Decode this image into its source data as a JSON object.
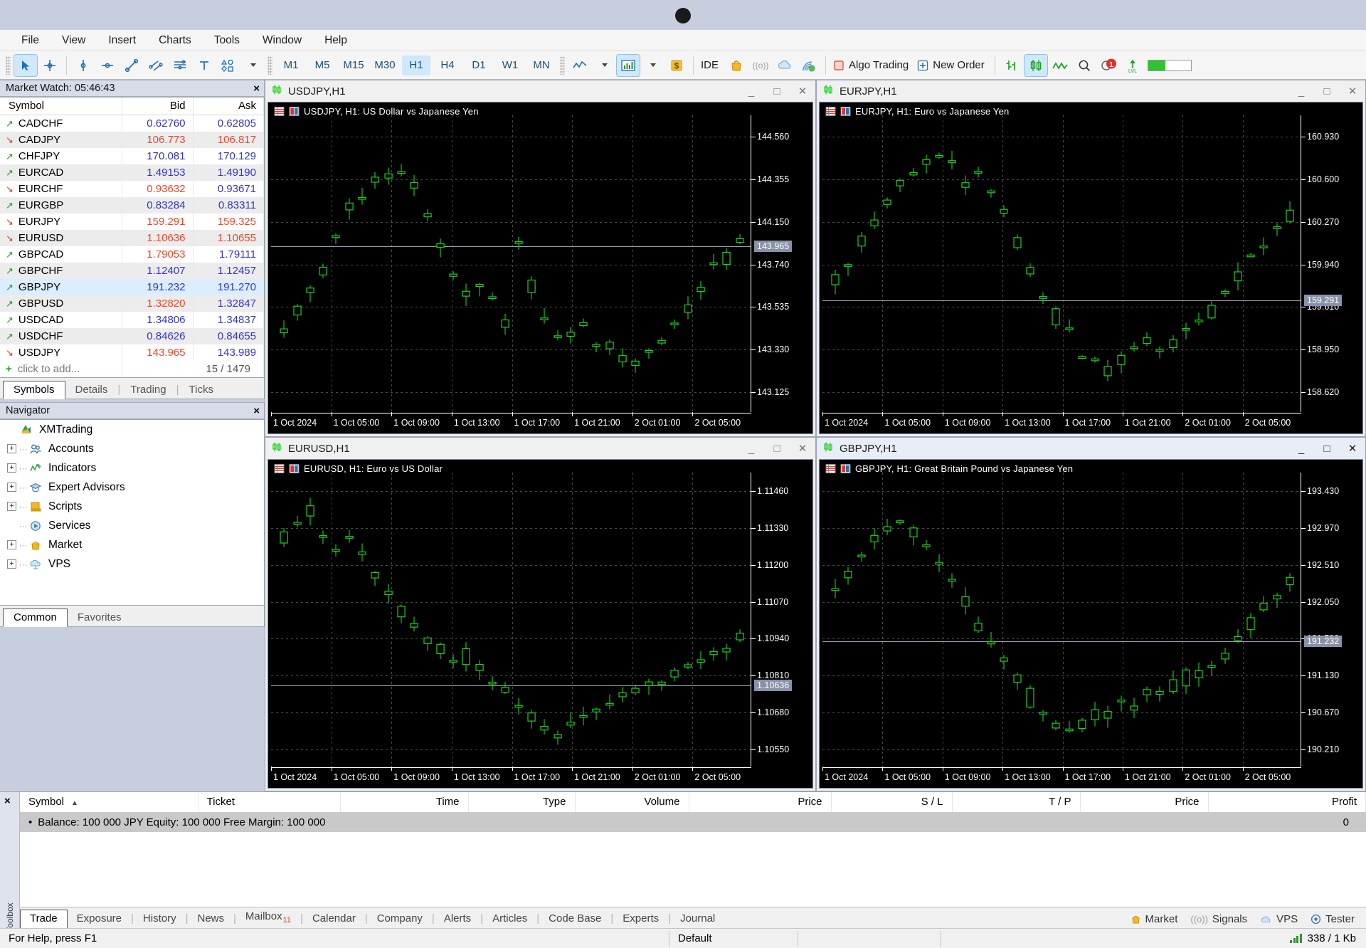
{
  "menu": [
    "File",
    "View",
    "Insert",
    "Charts",
    "Tools",
    "Window",
    "Help"
  ],
  "toolbar": {
    "timeframes": [
      "M1",
      "M5",
      "M15",
      "M30",
      "H1",
      "H4",
      "D1",
      "W1",
      "MN"
    ],
    "active_timeframe": "H1",
    "ide_label": "IDE",
    "algo_trading_label": "Algo Trading",
    "new_order_label": "New Order",
    "notification_badge": "1"
  },
  "market_watch": {
    "title": "Market Watch: 05:46:43",
    "close_label": "×",
    "columns": [
      "Symbol",
      "Bid",
      "Ask"
    ],
    "rows": [
      {
        "dir": "up",
        "symbol": "CADCHF",
        "bid": "0.62760",
        "bid_color": "blue",
        "ask": "0.62805",
        "ask_color": "blue"
      },
      {
        "dir": "down",
        "symbol": "CADJPY",
        "bid": "106.773",
        "bid_color": "red",
        "ask": "106.817",
        "ask_color": "red"
      },
      {
        "dir": "up",
        "symbol": "CHFJPY",
        "bid": "170.081",
        "bid_color": "blue",
        "ask": "170.129",
        "ask_color": "blue"
      },
      {
        "dir": "up",
        "symbol": "EURCAD",
        "bid": "1.49153",
        "bid_color": "blue",
        "ask": "1.49190",
        "ask_color": "blue"
      },
      {
        "dir": "down",
        "symbol": "EURCHF",
        "bid": "0.93632",
        "bid_color": "red",
        "ask": "0.93671",
        "ask_color": "blue"
      },
      {
        "dir": "up",
        "symbol": "EURGBP",
        "bid": "0.83284",
        "bid_color": "blue",
        "ask": "0.83311",
        "ask_color": "blue"
      },
      {
        "dir": "down",
        "symbol": "EURJPY",
        "bid": "159.291",
        "bid_color": "red",
        "ask": "159.325",
        "ask_color": "red"
      },
      {
        "dir": "down",
        "symbol": "EURUSD",
        "bid": "1.10636",
        "bid_color": "red",
        "ask": "1.10655",
        "ask_color": "red"
      },
      {
        "dir": "up",
        "symbol": "GBPCAD",
        "bid": "1.79053",
        "bid_color": "red",
        "ask": "1.79111",
        "ask_color": "blue"
      },
      {
        "dir": "up",
        "symbol": "GBPCHF",
        "bid": "1.12407",
        "bid_color": "blue",
        "ask": "1.12457",
        "ask_color": "blue"
      },
      {
        "dir": "up",
        "symbol": "GBPJPY",
        "bid": "191.232",
        "bid_color": "blue",
        "ask": "191.270",
        "ask_color": "blue",
        "selected": true
      },
      {
        "dir": "up",
        "symbol": "GBPUSD",
        "bid": "1.32820",
        "bid_color": "red",
        "ask": "1.32847",
        "ask_color": "blue"
      },
      {
        "dir": "up",
        "symbol": "USDCAD",
        "bid": "1.34806",
        "bid_color": "blue",
        "ask": "1.34837",
        "ask_color": "blue"
      },
      {
        "dir": "up",
        "symbol": "USDCHF",
        "bid": "0.84626",
        "bid_color": "blue",
        "ask": "0.84655",
        "ask_color": "blue"
      },
      {
        "dir": "down",
        "symbol": "USDJPY",
        "bid": "143.965",
        "bid_color": "red",
        "ask": "143.989",
        "ask_color": "blue"
      }
    ],
    "add_row_label": "click to add...",
    "counter": "15 / 1479",
    "tabs": [
      "Symbols",
      "Details",
      "Trading",
      "Ticks"
    ],
    "active_tab": "Symbols"
  },
  "navigator": {
    "title": "Navigator",
    "close_label": "×",
    "items": [
      {
        "label": "XMTrading",
        "icon": "broker-icon",
        "expandable": false,
        "root": true
      },
      {
        "label": "Accounts",
        "icon": "accounts-icon",
        "expandable": true
      },
      {
        "label": "Indicators",
        "icon": "indicators-icon",
        "expandable": true
      },
      {
        "label": "Expert Advisors",
        "icon": "expert-advisors-icon",
        "expandable": true
      },
      {
        "label": "Scripts",
        "icon": "scripts-icon",
        "expandable": true
      },
      {
        "label": "Services",
        "icon": "services-icon",
        "expandable": false
      },
      {
        "label": "Market",
        "icon": "market-icon",
        "expandable": true
      },
      {
        "label": "VPS",
        "icon": "vps-icon",
        "expandable": true
      }
    ],
    "tabs": [
      "Common",
      "Favorites"
    ],
    "active_tab": "Common"
  },
  "charts": [
    {
      "title": "USDJPY,H1",
      "label": "USDJPY, H1:  US Dollar vs Japanese Yen",
      "focused": false,
      "price_ticks": [
        "144.560",
        "144.355",
        "144.150",
        "143.740",
        "143.535",
        "143.330",
        "143.125"
      ],
      "current_price": "143.965",
      "time_ticks": [
        "1 Oct 2024",
        "1 Oct 05:00",
        "1 Oct 09:00",
        "1 Oct 13:00",
        "1 Oct 17:00",
        "1 Oct 21:00",
        "2 Oct 01:00",
        "2 Oct 05:00"
      ]
    },
    {
      "title": "EURJPY,H1",
      "label": "EURJPY, H1:  Euro vs Japanese Yen",
      "focused": false,
      "price_ticks": [
        "160.930",
        "160.600",
        "160.270",
        "159.940",
        "159.610",
        "158.950",
        "158.620"
      ],
      "current_price": "159.291",
      "time_ticks": [
        "1 Oct 2024",
        "1 Oct 05:00",
        "1 Oct 09:00",
        "1 Oct 13:00",
        "1 Oct 17:00",
        "1 Oct 21:00",
        "2 Oct 01:00",
        "2 Oct 05:00"
      ]
    },
    {
      "title": "EURUSD,H1",
      "label": "EURUSD, H1:  Euro vs US Dollar",
      "focused": false,
      "price_ticks": [
        "1.11460",
        "1.11330",
        "1.11200",
        "1.11070",
        "1.10940",
        "1.10810",
        "1.10680",
        "1.10550"
      ],
      "current_price": "1.10636",
      "time_ticks": [
        "1 Oct 2024",
        "1 Oct 05:00",
        "1 Oct 09:00",
        "1 Oct 13:00",
        "1 Oct 17:00",
        "1 Oct 21:00",
        "2 Oct 01:00",
        "2 Oct 05:00"
      ]
    },
    {
      "title": "GBPJPY,H1",
      "label": "GBPJPY, H1:  Great Britain Pound vs Japanese Yen",
      "focused": true,
      "price_ticks": [
        "193.430",
        "192.970",
        "192.510",
        "192.050",
        "191.590",
        "191.130",
        "190.670",
        "190.210"
      ],
      "current_price": "191.232",
      "time_ticks": [
        "1 Oct 2024",
        "1 Oct 05:00",
        "1 Oct 09:00",
        "1 Oct 13:00",
        "1 Oct 17:00",
        "1 Oct 21:00",
        "2 Oct 01:00",
        "2 Oct 05:00"
      ]
    }
  ],
  "chart_tabs": {
    "items": [
      "USDJPY,H1",
      "EURUSD,H1",
      "EURJPY,H1",
      "GBPJPY,H1"
    ],
    "active": "GBPJPY,H1"
  },
  "toolbox": {
    "close_label": "×",
    "side_label": "Toolbox",
    "columns": [
      "Symbol",
      "Ticket",
      "Time",
      "Type",
      "Volume",
      "Price",
      "S / L",
      "T / P",
      "Price",
      "Profit"
    ],
    "sort_column": "Symbol",
    "balance_text": "Balance: 100 000 JPY  Equity: 100 000  Free Margin: 100 000",
    "balance_profit": "0",
    "tabs": [
      "Trade",
      "Exposure",
      "History",
      "News",
      "Mailbox",
      "Calendar",
      "Company",
      "Alerts",
      "Articles",
      "Code Base",
      "Experts",
      "Journal"
    ],
    "active_tab": "Trade",
    "mailbox_badge": "11",
    "right_items": [
      "Market",
      "Signals",
      "VPS",
      "Tester"
    ]
  },
  "statusbar": {
    "help_text": "For Help, press F1",
    "profile": "Default",
    "network": "338 / 1 Kb"
  },
  "colors": {
    "accent": "#1f4e79",
    "up": "#13a413",
    "down": "#e03a1e",
    "bid_blue": "#3333cc",
    "bid_red": "#f0452a",
    "chart_bg": "#000000",
    "candle_green": "#19d219"
  },
  "chart_data": {
    "type": "candlestick",
    "note": "Four H1 forex charts, 1 Oct 2024 00:00 - 2 Oct 2024 05:00"
  }
}
